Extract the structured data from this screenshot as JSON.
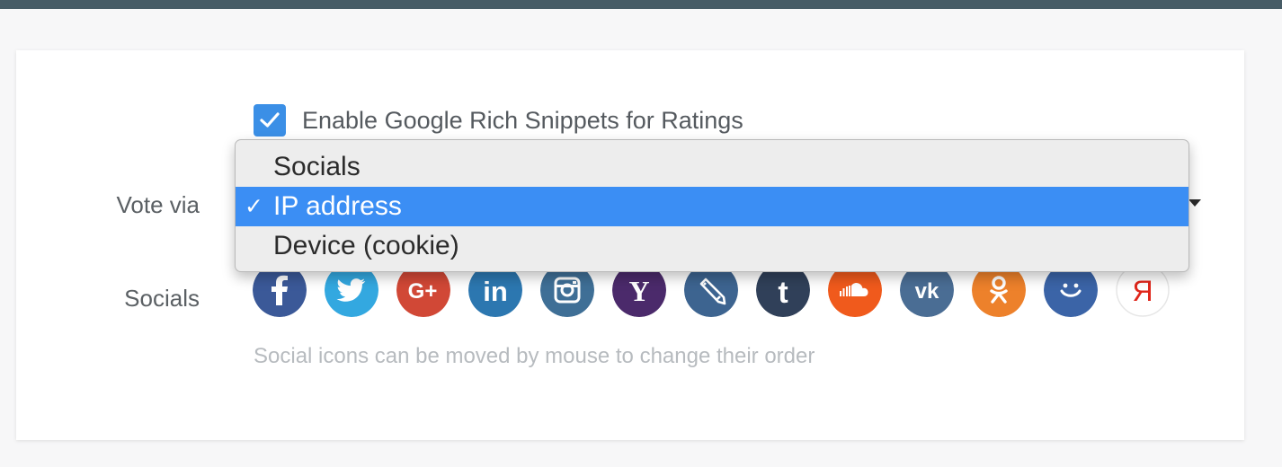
{
  "rich_snippets": {
    "label": "Enable Google Rich Snippets for Ratings",
    "checked": true
  },
  "vote_via": {
    "label": "Vote via",
    "selected": "IP address",
    "options": [
      {
        "label": "Socials",
        "selected": false
      },
      {
        "label": "IP address",
        "selected": true
      },
      {
        "label": "Device (cookie)",
        "selected": false
      }
    ],
    "check_mark": "✓"
  },
  "socials": {
    "label": "Socials",
    "hint": "Social icons can be moved by mouse to change their order",
    "icons": [
      {
        "name": "facebook",
        "color": "#3b5998"
      },
      {
        "name": "twitter",
        "color": "#33a8e0"
      },
      {
        "name": "google-plus",
        "color": "#d14836"
      },
      {
        "name": "linkedin",
        "color": "#2c77b0"
      },
      {
        "name": "instagram",
        "color": "#3f6f96"
      },
      {
        "name": "yahoo",
        "color": "#4b2a6b"
      },
      {
        "name": "livejournal",
        "color": "#3d6490"
      },
      {
        "name": "tumblr",
        "color": "#304059"
      },
      {
        "name": "soundcloud",
        "color": "#f05a1c"
      },
      {
        "name": "vk",
        "color": "#4a6d94"
      },
      {
        "name": "odnoklassniki",
        "color": "#ed812b"
      },
      {
        "name": "mail-ru",
        "color": "#3b64a7"
      },
      {
        "name": "yandex",
        "color": "#ffffff"
      }
    ]
  }
}
